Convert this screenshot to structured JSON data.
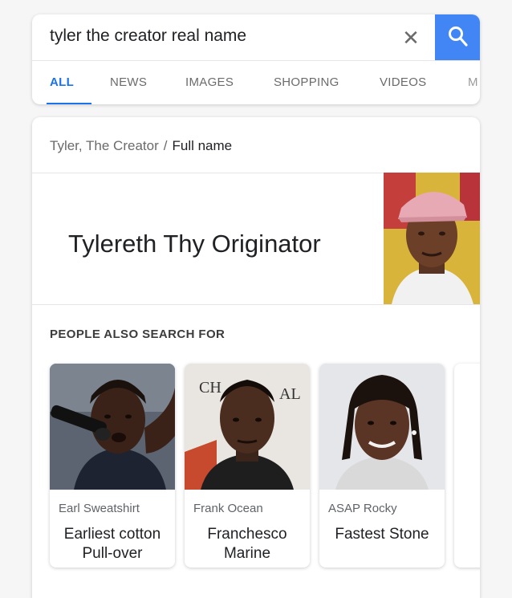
{
  "search": {
    "query": "tyler the creator real name",
    "clear_icon": "close-icon",
    "search_icon": "search-icon",
    "accent": "#4285f4"
  },
  "tabs": [
    {
      "label": "ALL",
      "active": true
    },
    {
      "label": "NEWS"
    },
    {
      "label": "IMAGES"
    },
    {
      "label": "SHOPPING"
    },
    {
      "label": "VIDEOS"
    },
    {
      "label": "M"
    }
  ],
  "breadcrumb": {
    "entity": "Tyler, The Creator",
    "separator": "/",
    "attribute": "Full name"
  },
  "answer": "Tylereth Thy Originator",
  "people_also_search": {
    "title": "PEOPLE ALSO SEARCH FOR",
    "items": [
      {
        "name": "Earl Sweatshirt",
        "alt": "Earliest cotton Pull-over"
      },
      {
        "name": "Frank Ocean",
        "alt": "Franchesco Marine"
      },
      {
        "name": "ASAP Rocky",
        "alt": "Fastest Stone"
      }
    ]
  }
}
